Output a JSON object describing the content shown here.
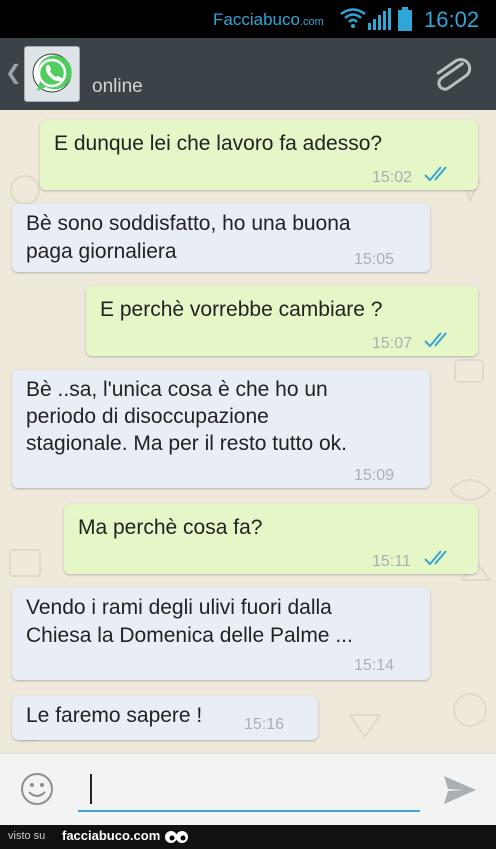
{
  "status_bar": {
    "brand": "Facciabuco",
    "brand_suffix": ".com",
    "time": "16:02"
  },
  "header": {
    "contact_status": "online",
    "icons": [
      "back-icon",
      "whatsapp-avatar-icon",
      "paperclip-icon"
    ]
  },
  "messages": [
    {
      "direction": "out",
      "text": "E dunque lei che lavoro fa adesso?",
      "time": "15:02",
      "read": true
    },
    {
      "direction": "in",
      "text": "Bè sono soddisfatto, ho una buona\npaga giornaliera",
      "time": "15:05"
    },
    {
      "direction": "out",
      "text": "E perchè vorrebbe cambiare ?",
      "time": "15:07",
      "read": true
    },
    {
      "direction": "in",
      "text": "Bè ..sa, l'unica cosa è che ho un\nperiodo di disoccupazione\nstagionale. Ma per il resto tutto ok.",
      "time": "15:09"
    },
    {
      "direction": "out",
      "text": "Ma perchè cosa fa?",
      "time": "15:11",
      "read": true
    },
    {
      "direction": "in",
      "text": "Vendo i rami degli ulivi fuori dalla\nChiesa la Domenica delle Palme ...",
      "time": "15:14"
    },
    {
      "direction": "in",
      "text": "Le faremo sapere !",
      "time": "15:16"
    }
  ],
  "input": {
    "value": "",
    "icons": [
      "emoji-icon",
      "send-icon"
    ]
  },
  "footer": {
    "prefix": "visto su",
    "brand": "facciabuco.com"
  },
  "colors": {
    "status_accent": "#2ea6d8",
    "action_bar": "#3b4248",
    "chat_background": "#efe9dc",
    "outgoing_bubble": "#e5f7c7",
    "incoming_bubble": "#e9edf6",
    "read_ticks": "#3aa6cf"
  }
}
